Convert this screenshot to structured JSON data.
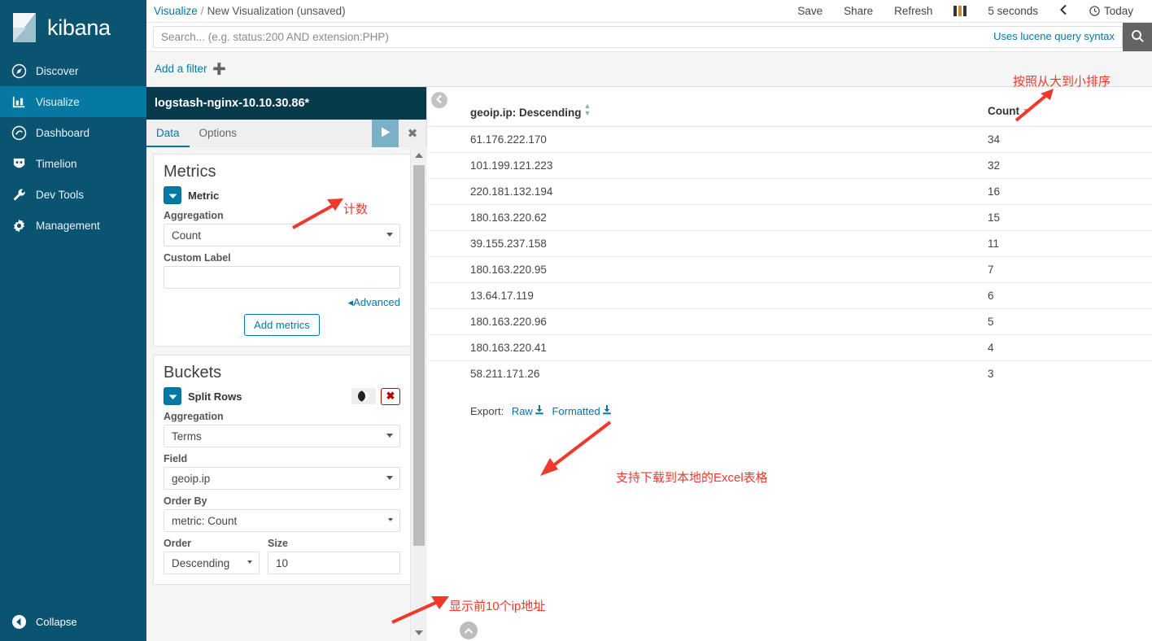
{
  "app": {
    "name": "kibana",
    "logo_icon": "kibana-logo"
  },
  "sidebar": {
    "collapse_label": "Collapse",
    "items": [
      {
        "label": "Discover",
        "icon": "compass-icon"
      },
      {
        "label": "Visualize",
        "icon": "bar-chart-icon"
      },
      {
        "label": "Dashboard",
        "icon": "dashboard-icon"
      },
      {
        "label": "Timelion",
        "icon": "timelion-icon"
      },
      {
        "label": "Dev Tools",
        "icon": "wrench-icon"
      },
      {
        "label": "Management",
        "icon": "gear-icon"
      }
    ],
    "active_index": 1
  },
  "breadcrumb": {
    "root": "Visualize",
    "separator": "/",
    "current": "New Visualization (unsaved)"
  },
  "topnav": {
    "save": "Save",
    "share": "Share",
    "refresh": "Refresh",
    "pause_icon": "pause-icon",
    "interval": "5 seconds",
    "back_icon": "chevron-left-icon",
    "time_icon": "clock-icon",
    "time_range": "Today"
  },
  "search": {
    "placeholder": "Search... (e.g. status:200 AND extension:PHP)",
    "value": "",
    "hint": "Uses lucene query syntax",
    "submit_icon": "search-icon"
  },
  "filters": {
    "add_label": "Add a filter",
    "add_icon": "plus-icon"
  },
  "editor": {
    "index_title": "logstash-nginx-10.10.30.86*",
    "tabs": [
      {
        "label": "Data"
      },
      {
        "label": "Options"
      }
    ],
    "active_tab": 0,
    "apply_icon": "play-icon",
    "close_icon": "close-icon",
    "metrics": {
      "heading": "Metrics",
      "agg_label": "Metric",
      "aggregation_label": "Aggregation",
      "aggregation_value": "Count",
      "custom_label_label": "Custom Label",
      "custom_label_value": "",
      "advanced_label": "Advanced",
      "advanced_icon": "caret-left-icon",
      "add_metrics_label": "Add metrics"
    },
    "buckets": {
      "heading": "Buckets",
      "agg_label": "Split Rows",
      "toggle_icon": "toggle-icon",
      "remove_icon": "remove-x-icon",
      "aggregation_label": "Aggregation",
      "aggregation_value": "Terms",
      "field_label": "Field",
      "field_value": "geoip.ip",
      "order_by_label": "Order By",
      "order_by_value": "metric: Count",
      "order_label": "Order",
      "order_value": "Descending",
      "size_label": "Size",
      "size_value": "10"
    }
  },
  "visualization": {
    "collapse_icon": "chevron-left-circle-icon",
    "scroll_top_icon": "chevron-up-circle-icon",
    "export": {
      "label": "Export:",
      "raw_label": "Raw",
      "formatted_label": "Formatted",
      "download_icon": "download-icon"
    },
    "table": {
      "columns": [
        {
          "label": "geoip.ip: Descending",
          "sort_icon": "sort-both-icon"
        },
        {
          "label": "Count",
          "sort_icon": "caret-down-icon"
        }
      ],
      "rows": [
        {
          "ip": "61.176.222.170",
          "count": "34"
        },
        {
          "ip": "101.199.121.223",
          "count": "32"
        },
        {
          "ip": "220.181.132.194",
          "count": "16"
        },
        {
          "ip": "180.163.220.62",
          "count": "15"
        },
        {
          "ip": "39.155.237.158",
          "count": "11"
        },
        {
          "ip": "180.163.220.95",
          "count": "7"
        },
        {
          "ip": "13.64.17.119",
          "count": "6"
        },
        {
          "ip": "180.163.220.96",
          "count": "5"
        },
        {
          "ip": "180.163.220.41",
          "count": "4"
        },
        {
          "ip": "58.211.171.26",
          "count": "3"
        }
      ]
    }
  },
  "annotations": [
    {
      "text": "按照从大到小排序",
      "note": "sort-descending"
    },
    {
      "text": "计数",
      "note": "count-metric"
    },
    {
      "text": "支持下载到本地的Excel表格",
      "note": "export-excel"
    },
    {
      "text": "显示前10个ip地址",
      "note": "top-10-ips"
    }
  ],
  "chart_data": {
    "type": "table",
    "title": "geoip.ip terms aggregation",
    "columns": [
      "geoip.ip: Descending",
      "Count"
    ],
    "categories": [
      "61.176.222.170",
      "101.199.121.223",
      "220.181.132.194",
      "180.163.220.62",
      "39.155.237.158",
      "180.163.220.95",
      "13.64.17.119",
      "180.163.220.96",
      "180.163.220.41",
      "58.211.171.26"
    ],
    "values": [
      34,
      32,
      16,
      15,
      11,
      7,
      6,
      5,
      4,
      3
    ],
    "xlabel": "geoip.ip",
    "ylabel": "Count",
    "sort": "descending",
    "size": 10
  },
  "colors": {
    "sidebar_bg": "#0a5471",
    "sidebar_active": "#0679a3",
    "panel_header": "#073b4c",
    "accent_link": "#0079a5",
    "annotation": "#f0382b",
    "apply_button": "#7cb0c6"
  }
}
